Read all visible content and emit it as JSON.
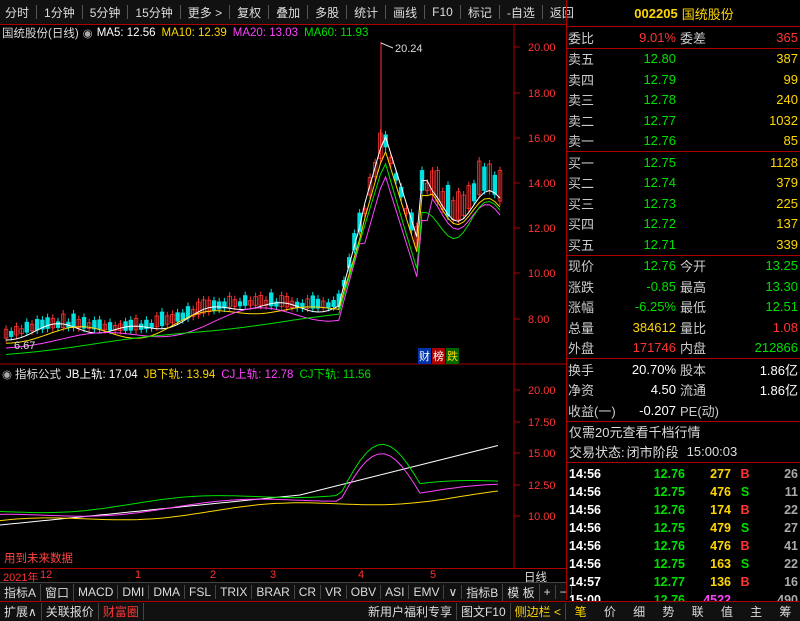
{
  "toolbar": {
    "left": [
      "分时",
      "1分钟",
      "5分钟",
      "15分钟",
      "更多 >"
    ],
    "right": [
      "复权",
      "叠加",
      "多股",
      "统计",
      "画线",
      "F10",
      "标记",
      "-自选",
      "返回"
    ]
  },
  "main_chart": {
    "title": "国统股份(日线)",
    "ma_labels": [
      {
        "text": "MA5: 12.56",
        "color": "#ffffff"
      },
      {
        "text": "MA10: 12.39",
        "color": "#ffd700"
      },
      {
        "text": "MA20: 13.03",
        "color": "#ff44ff"
      },
      {
        "text": "MA60: 11.93",
        "color": "#00e000"
      }
    ],
    "price_axis": [
      "20.00",
      "18.00",
      "16.00",
      "14.00",
      "12.00",
      "10.00",
      "8.00"
    ],
    "high_label": "20.24",
    "low_label": "6.67",
    "badges": [
      "财",
      "榜",
      "跌"
    ]
  },
  "indicator_chart": {
    "title": "指标公式",
    "labels": [
      {
        "text": "JB上轨: 17.04",
        "color": "#ffffff"
      },
      {
        "text": "JB下轨: 13.94",
        "color": "#ffd700"
      },
      {
        "text": "CJ上轨: 12.78",
        "color": "#ff44ff"
      },
      {
        "text": "CJ下轨: 11.56",
        "color": "#00e000"
      }
    ],
    "axis": [
      "20.00",
      "17.50",
      "15.00",
      "12.50",
      "10.00"
    ],
    "footnote": "用到未来数据"
  },
  "time_axis": {
    "year": "2021年",
    "months": [
      "12",
      "1",
      "2",
      "3",
      "4",
      "5"
    ],
    "period": "日线"
  },
  "quote": {
    "code": "002205",
    "name": "国统股份",
    "weibi_label": "委比",
    "weibi": "9.01%",
    "weicha_label": "委差",
    "weicha": "365",
    "asks": [
      {
        "label": "卖五",
        "price": "12.80",
        "vol": "387"
      },
      {
        "label": "卖四",
        "price": "12.79",
        "vol": "99"
      },
      {
        "label": "卖三",
        "price": "12.78",
        "vol": "240"
      },
      {
        "label": "卖二",
        "price": "12.77",
        "vol": "1032"
      },
      {
        "label": "卖一",
        "price": "12.76",
        "vol": "85"
      }
    ],
    "bids": [
      {
        "label": "买一",
        "price": "12.75",
        "vol": "1128"
      },
      {
        "label": "买二",
        "price": "12.74",
        "vol": "379"
      },
      {
        "label": "买三",
        "price": "12.73",
        "vol": "225"
      },
      {
        "label": "买四",
        "price": "12.72",
        "vol": "137"
      },
      {
        "label": "买五",
        "price": "12.71",
        "vol": "339"
      }
    ],
    "stats1": [
      {
        "l1": "现价",
        "v1": "12.76",
        "c1": "#00e000",
        "l2": "今开",
        "v2": "13.25",
        "c2": "#00e000"
      },
      {
        "l1": "涨跌",
        "v1": "-0.85",
        "c1": "#00e000",
        "l2": "最高",
        "v2": "13.30",
        "c2": "#00e000"
      },
      {
        "l1": "涨幅",
        "v1": "-6.25%",
        "c1": "#00e000",
        "l2": "最低",
        "v2": "12.51",
        "c2": "#00e000"
      },
      {
        "l1": "总量",
        "v1": "384612",
        "c1": "#ffd700",
        "l2": "量比",
        "v2": "1.08",
        "c2": "#ff3333"
      },
      {
        "l1": "外盘",
        "v1": "171746",
        "c1": "#ff3333",
        "l2": "内盘",
        "v2": "212866",
        "c2": "#00e000"
      }
    ],
    "stats2": [
      {
        "l1": "换手",
        "v1": "20.70%",
        "l2": "股本",
        "v2": "1.86亿"
      },
      {
        "l1": "净资",
        "v1": "4.50",
        "l2": "流通",
        "v2": "1.86亿"
      },
      {
        "l1": "收益(一)",
        "v1": "-0.207",
        "l2": "PE(动)",
        "v2": ""
      }
    ],
    "promo": "仅需20元查看千档行情",
    "trade_status_label": "交易状态:",
    "trade_status": "闭市阶段",
    "trade_time": "15:00:03",
    "ticks": [
      {
        "t": "14:56",
        "p": "12.76",
        "v": "277",
        "d": "B",
        "n": "26"
      },
      {
        "t": "14:56",
        "p": "12.75",
        "v": "476",
        "d": "S",
        "n": "11"
      },
      {
        "t": "14:56",
        "p": "12.76",
        "v": "174",
        "d": "B",
        "n": "22"
      },
      {
        "t": "14:56",
        "p": "12.75",
        "v": "479",
        "d": "S",
        "n": "27"
      },
      {
        "t": "14:56",
        "p": "12.76",
        "v": "476",
        "d": "B",
        "n": "41"
      },
      {
        "t": "14:56",
        "p": "12.75",
        "v": "163",
        "d": "S",
        "n": "22"
      },
      {
        "t": "14:57",
        "p": "12.77",
        "v": "136",
        "d": "B",
        "n": "16"
      },
      {
        "t": "15:00",
        "p": "12.76",
        "v": "4522",
        "d": "",
        "n": "490"
      }
    ]
  },
  "indicator_tabs": [
    "指标A",
    "窗口",
    "MACD",
    "DMI",
    "DMA",
    "FSL",
    "TRIX",
    "BRAR",
    "CR",
    "VR",
    "OBV",
    "ASI",
    "EMV",
    "∨",
    "指标B",
    "模 板",
    "+",
    "−"
  ],
  "status_bar": {
    "left": [
      "扩展∧",
      "关联报价",
      "财富圈"
    ],
    "right": [
      "新用户福利专享",
      "图文F10",
      "侧边栏 <"
    ],
    "icons": [
      "笔",
      "价",
      "细",
      "势",
      "联",
      "值",
      "主",
      "筹"
    ]
  }
}
